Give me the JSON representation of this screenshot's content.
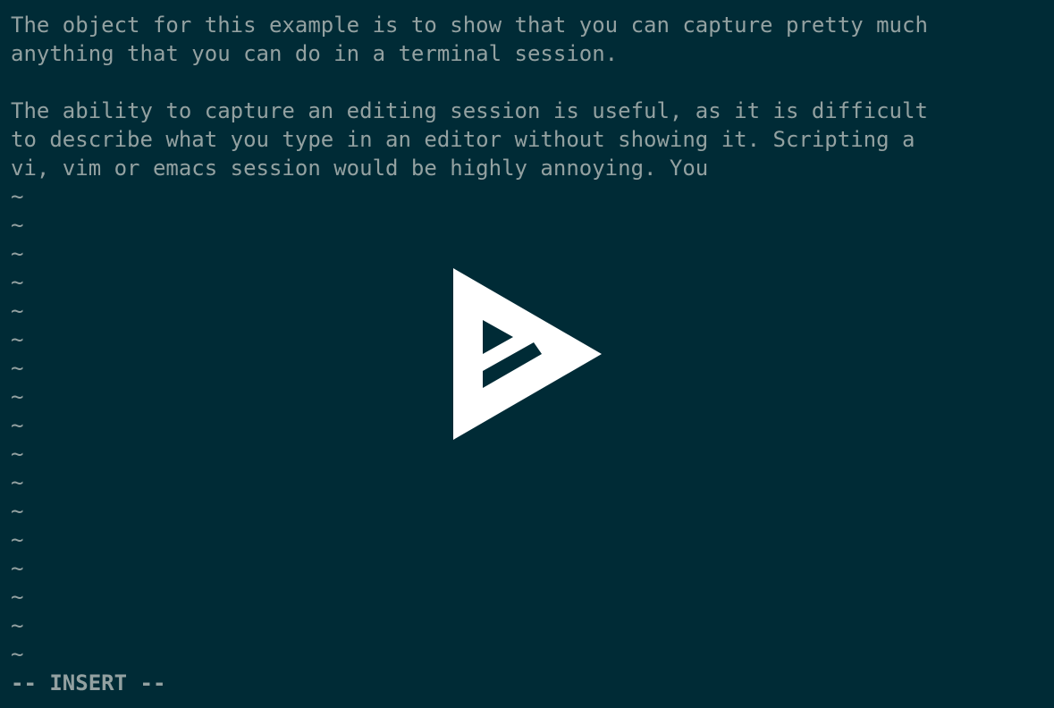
{
  "terminal": {
    "background_color": "#002b36",
    "text_color": "#93a1a1",
    "lines": [
      "The object for this example is to show that you can capture pretty much",
      "anything that you can do in a terminal session.",
      "",
      "The ability to capture an editing session is useful, as it is difficult",
      "to describe what you type in an editor without showing it. Scripting a",
      "vi, vim or emacs session would be highly annoying. You"
    ],
    "empty_line_marker": "~",
    "empty_line_count": 17,
    "mode_indicator": "-- INSERT --"
  },
  "player": {
    "play_icon": "asciinema-play-icon",
    "icon_color": "#ffffff"
  }
}
